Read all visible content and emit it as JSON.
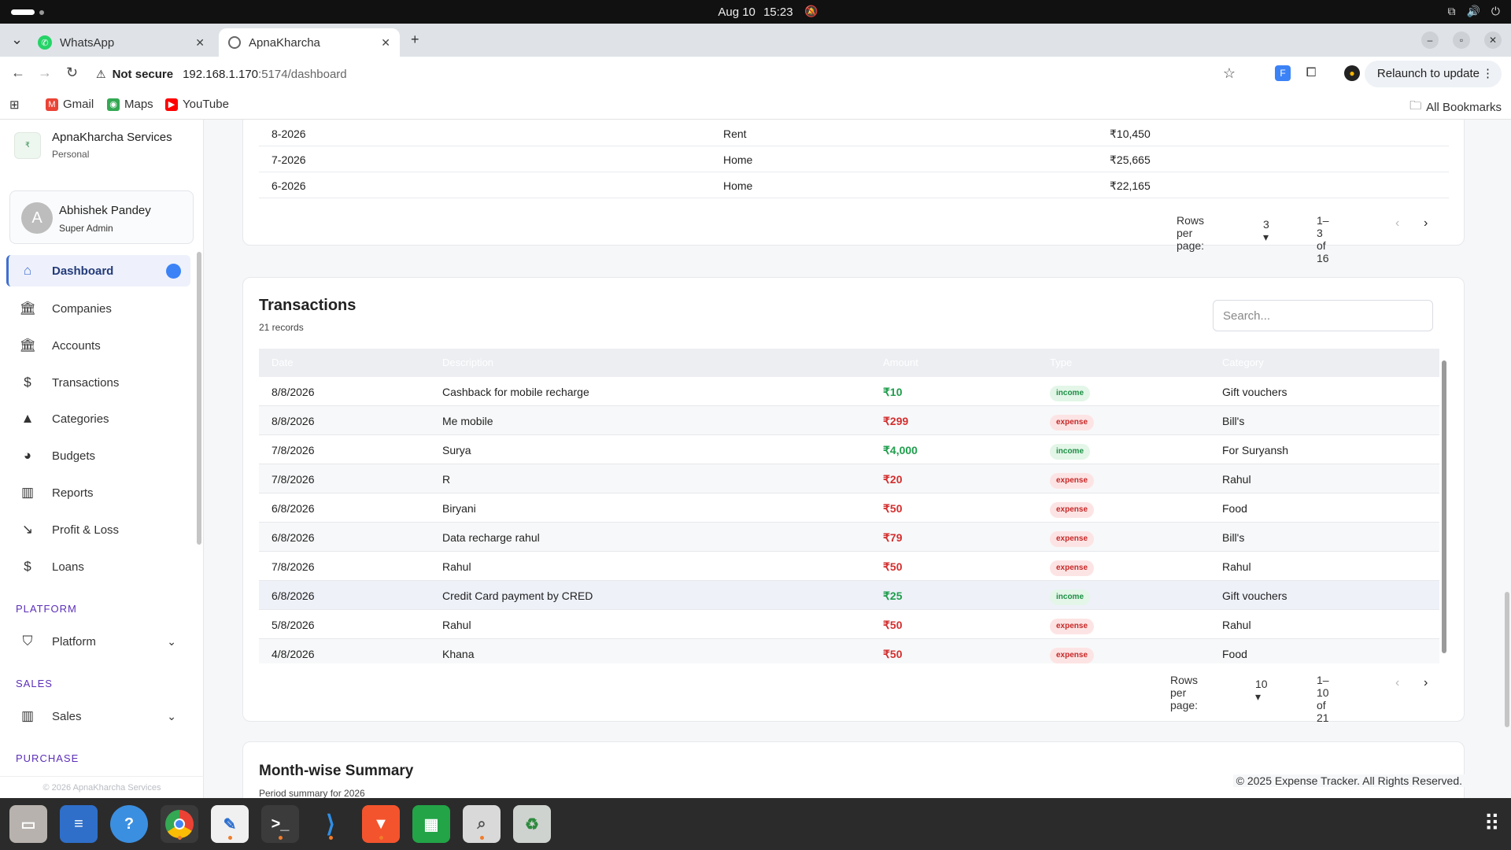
{
  "system": {
    "date": "Aug 10",
    "time": "15:23"
  },
  "browser": {
    "tabs": [
      {
        "label": "WhatsApp"
      },
      {
        "label": "ApnaKharcha"
      }
    ],
    "url_host": "192.168.1.170",
    "url_path": ":5174/dashboard",
    "security_label": "Not secure",
    "relaunch_label": "Relaunch to update",
    "bookmarks": [
      "Gmail",
      "Maps",
      "YouTube"
    ],
    "all_bookmarks_label": "All Bookmarks"
  },
  "sidebar": {
    "brand_name": "ApnaKharcha Services",
    "brand_sub": "Personal",
    "user_initial": "A",
    "user_name": "Abhishek Pandey",
    "user_role": "Super Admin",
    "items": [
      {
        "label": "Dashboard",
        "icon": "home-icon"
      },
      {
        "label": "Companies",
        "icon": "bank-icon"
      },
      {
        "label": "Accounts",
        "icon": "bank-icon"
      },
      {
        "label": "Transactions",
        "icon": "dollar-icon"
      },
      {
        "label": "Categories",
        "icon": "shapes-icon"
      },
      {
        "label": "Budgets",
        "icon": "pie-icon"
      },
      {
        "label": "Reports",
        "icon": "bar-chart-icon"
      },
      {
        "label": "Profit & Loss",
        "icon": "trend-down-icon"
      },
      {
        "label": "Loans",
        "icon": "coin-icon"
      }
    ],
    "sections": [
      {
        "label": "PLATFORM",
        "item": "Platform"
      },
      {
        "label": "SALES",
        "item": "Sales"
      },
      {
        "label": "PURCHASE"
      }
    ],
    "footer": "© 2026 ApnaKharcha Services"
  },
  "budget_table": {
    "rows": [
      {
        "period": "8-2026",
        "category": "Rent",
        "amount": "₹10,450"
      },
      {
        "period": "7-2026",
        "category": "Home",
        "amount": "₹25,665"
      },
      {
        "period": "6-2026",
        "category": "Home",
        "amount": "₹22,165"
      }
    ],
    "rows_per_page_label": "Rows per page:",
    "rows_per_page": "3",
    "range": "1–3 of 16"
  },
  "transactions": {
    "title": "Transactions",
    "count": "21 records",
    "search_placeholder": "Search...",
    "columns": [
      "Date",
      "Description",
      "Amount",
      "Type",
      "Category"
    ],
    "rows": [
      {
        "date": "8/8/2026",
        "desc": "Cashback for mobile recharge",
        "amount": "₹10",
        "type": "income",
        "category": "Gift vouchers"
      },
      {
        "date": "8/8/2026",
        "desc": "Me mobile",
        "amount": "₹299",
        "type": "expense",
        "category": "Bill's"
      },
      {
        "date": "7/8/2026",
        "desc": "Surya",
        "amount": "₹4,000",
        "type": "income",
        "category": "For Suryansh"
      },
      {
        "date": "7/8/2026",
        "desc": "R",
        "amount": "₹20",
        "type": "expense",
        "category": "Rahul"
      },
      {
        "date": "6/8/2026",
        "desc": "Biryani",
        "amount": "₹50",
        "type": "expense",
        "category": "Food"
      },
      {
        "date": "6/8/2026",
        "desc": "Data recharge rahul",
        "amount": "₹79",
        "type": "expense",
        "category": "Bill's"
      },
      {
        "date": "7/8/2026",
        "desc": "Rahul",
        "amount": "₹50",
        "type": "expense",
        "category": "Rahul"
      },
      {
        "date": "6/8/2026",
        "desc": "Credit Card payment by CRED",
        "amount": "₹25",
        "type": "income",
        "category": "Gift vouchers"
      },
      {
        "date": "5/8/2026",
        "desc": "Rahul",
        "amount": "₹50",
        "type": "expense",
        "category": "Rahul"
      },
      {
        "date": "4/8/2026",
        "desc": "Khana",
        "amount": "₹50",
        "type": "expense",
        "category": "Food"
      }
    ],
    "rows_per_page_label": "Rows per page:",
    "rows_per_page": "10",
    "range": "1–10 of 21"
  },
  "month_summary": {
    "title": "Month-wise Summary",
    "subtitle": "Period summary for 2026"
  },
  "app_footer": "© 2025 Expense Tracker. All Rights Reserved."
}
